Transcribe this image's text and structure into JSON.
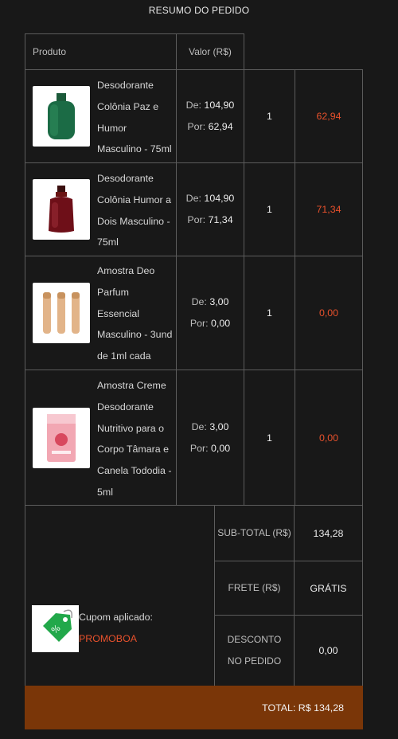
{
  "page": {
    "title": "RESUMO DO PEDIDO"
  },
  "table": {
    "headers": {
      "product": "Produto",
      "value": "Valor (R$)"
    },
    "items": [
      {
        "name_lines": [
          "Desodorante",
          "Colônia Paz e",
          "Humor",
          "Masculino - 75ml"
        ],
        "de_label": "De:",
        "de": "104,90",
        "por_label": "Por:",
        "por": "62,94",
        "qty": "1",
        "total": "62,94",
        "image": "green-perfume-bottle-image"
      },
      {
        "name_lines": [
          "Desodorante",
          "Colônia Humor a",
          "Dois Masculino -",
          "75ml"
        ],
        "de_label": "De:",
        "de": "104,90",
        "por_label": "Por:",
        "por": "71,34",
        "qty": "1",
        "total": "71,34",
        "image": "red-perfume-bottle-image"
      },
      {
        "name_lines": [
          "Amostra Deo",
          "Parfum",
          "Essencial",
          "Masculino - 3und",
          "de 1ml cada"
        ],
        "de_label": "De:",
        "de": "3,00",
        "por_label": "Por:",
        "por": "0,00",
        "qty": "1",
        "total": "0,00",
        "image": "sample-vials-image"
      },
      {
        "name_lines": [
          "Amostra Creme",
          "Desodorante",
          "Nutritivo para o",
          "Corpo Tâmara e",
          "Canela Tododia -",
          "5ml"
        ],
        "de_label": "De:",
        "de": "3,00",
        "por_label": "Por:",
        "por": "0,00",
        "qty": "1",
        "total": "0,00",
        "image": "cream-sachet-image"
      }
    ]
  },
  "summary": {
    "subtotal_label": "SUB-TOTAL (R$)",
    "subtotal": "134,28",
    "frete_label": "FRETE (R$)",
    "frete": "GRÁTIS",
    "desconto_label_line1": "DESCONTO",
    "desconto_label_line2": "NO PEDIDO",
    "desconto": "0,00"
  },
  "coupon": {
    "label": "Cupom aplicado:",
    "code": "PROMOBOA",
    "icon": "percent-tag-icon"
  },
  "footer": {
    "total": "TOTAL: R$ 134,28"
  },
  "colors": {
    "background": "#181818",
    "accent": "#e8512c",
    "footer": "#7a3608",
    "border": "#5c5c5c"
  }
}
